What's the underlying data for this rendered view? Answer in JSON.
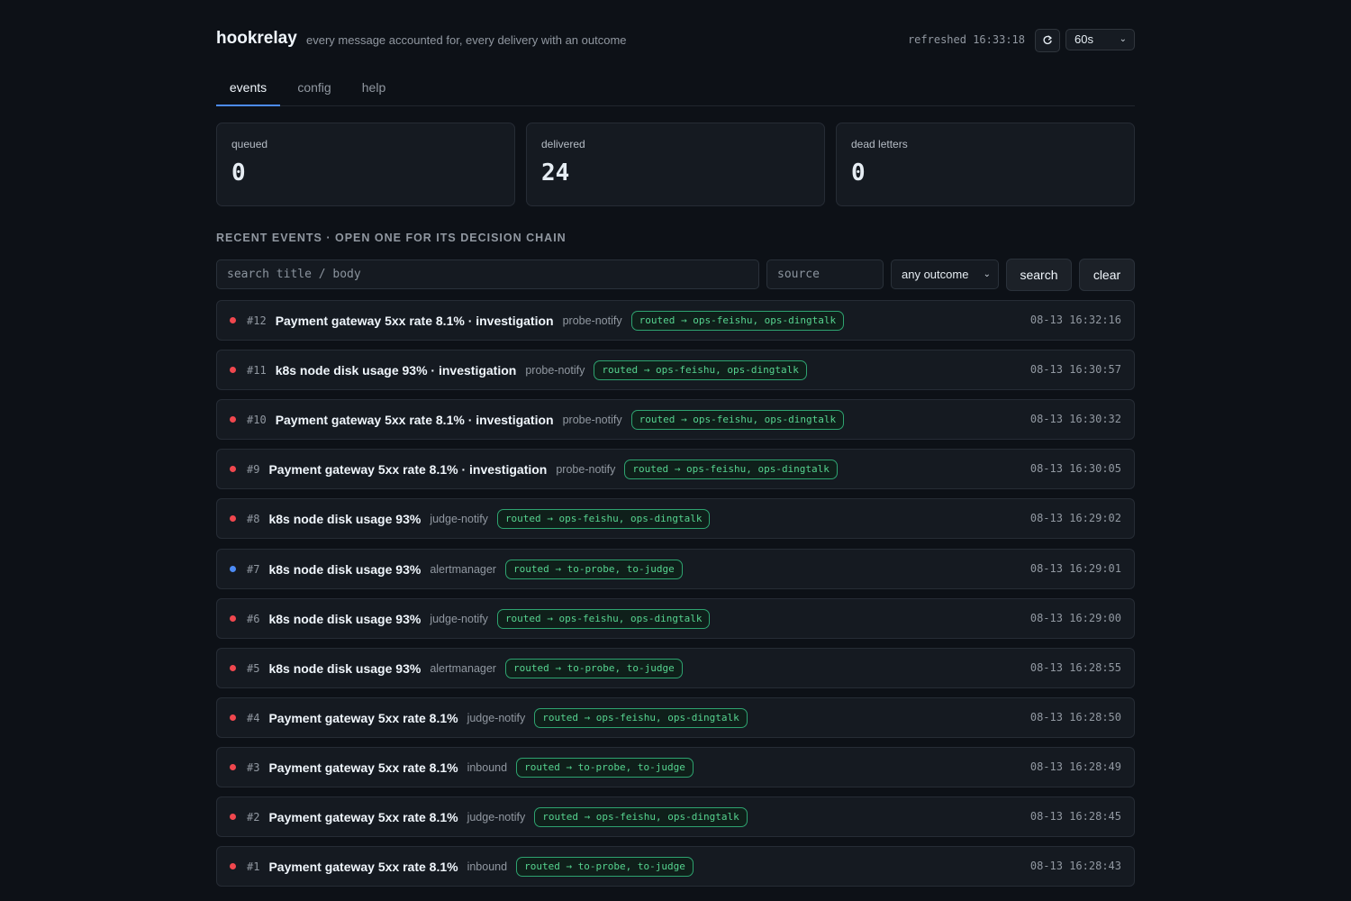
{
  "header": {
    "brand": "hookrelay",
    "tagline": "every message accounted for, every delivery with an outcome",
    "refreshed": "refreshed 16:33:18",
    "interval": "60s"
  },
  "tabs": [
    {
      "label": "events",
      "active": true
    },
    {
      "label": "config",
      "active": false
    },
    {
      "label": "help",
      "active": false
    }
  ],
  "stats": [
    {
      "label": "queued",
      "value": "0"
    },
    {
      "label": "delivered",
      "value": "24"
    },
    {
      "label": "dead letters",
      "value": "0"
    }
  ],
  "section": {
    "title": "RECENT EVENTS · OPEN ONE FOR ITS DECISION CHAIN"
  },
  "filters": {
    "search_placeholder": "search title / body",
    "source_placeholder": "source",
    "outcome": "any outcome",
    "search_label": "search",
    "clear_label": "clear"
  },
  "colors": {
    "background": "#0d1117",
    "accent": "#4c8bf5",
    "status_red": "#f0474e",
    "status_blue": "#4c8bf5",
    "routed_green": "#56d38f"
  },
  "events": [
    {
      "id": "#12",
      "title": "Payment gateway 5xx rate 8.1% · investigation",
      "source": "probe-notify",
      "outcome": "routed → ops-feishu, ops-dingtalk",
      "time": "08-13 16:32:16",
      "status": "red"
    },
    {
      "id": "#11",
      "title": "k8s node disk usage 93% · investigation",
      "source": "probe-notify",
      "outcome": "routed → ops-feishu, ops-dingtalk",
      "time": "08-13 16:30:57",
      "status": "red"
    },
    {
      "id": "#10",
      "title": "Payment gateway 5xx rate 8.1% · investigation",
      "source": "probe-notify",
      "outcome": "routed → ops-feishu, ops-dingtalk",
      "time": "08-13 16:30:32",
      "status": "red"
    },
    {
      "id": "#9",
      "title": "Payment gateway 5xx rate 8.1% · investigation",
      "source": "probe-notify",
      "outcome": "routed → ops-feishu, ops-dingtalk",
      "time": "08-13 16:30:05",
      "status": "red"
    },
    {
      "id": "#8",
      "title": "k8s node disk usage 93%",
      "source": "judge-notify",
      "outcome": "routed → ops-feishu, ops-dingtalk",
      "time": "08-13 16:29:02",
      "status": "red"
    },
    {
      "id": "#7",
      "title": "k8s node disk usage 93%",
      "source": "alertmanager",
      "outcome": "routed → to-probe, to-judge",
      "time": "08-13 16:29:01",
      "status": "blue"
    },
    {
      "id": "#6",
      "title": "k8s node disk usage 93%",
      "source": "judge-notify",
      "outcome": "routed → ops-feishu, ops-dingtalk",
      "time": "08-13 16:29:00",
      "status": "red"
    },
    {
      "id": "#5",
      "title": "k8s node disk usage 93%",
      "source": "alertmanager",
      "outcome": "routed → to-probe, to-judge",
      "time": "08-13 16:28:55",
      "status": "red"
    },
    {
      "id": "#4",
      "title": "Payment gateway 5xx rate 8.1%",
      "source": "judge-notify",
      "outcome": "routed → ops-feishu, ops-dingtalk",
      "time": "08-13 16:28:50",
      "status": "red"
    },
    {
      "id": "#3",
      "title": "Payment gateway 5xx rate 8.1%",
      "source": "inbound",
      "outcome": "routed → to-probe, to-judge",
      "time": "08-13 16:28:49",
      "status": "red"
    },
    {
      "id": "#2",
      "title": "Payment gateway 5xx rate 8.1%",
      "source": "judge-notify",
      "outcome": "routed → ops-feishu, ops-dingtalk",
      "time": "08-13 16:28:45",
      "status": "red"
    },
    {
      "id": "#1",
      "title": "Payment gateway 5xx rate 8.1%",
      "source": "inbound",
      "outcome": "routed → to-probe, to-judge",
      "time": "08-13 16:28:43",
      "status": "red"
    }
  ]
}
